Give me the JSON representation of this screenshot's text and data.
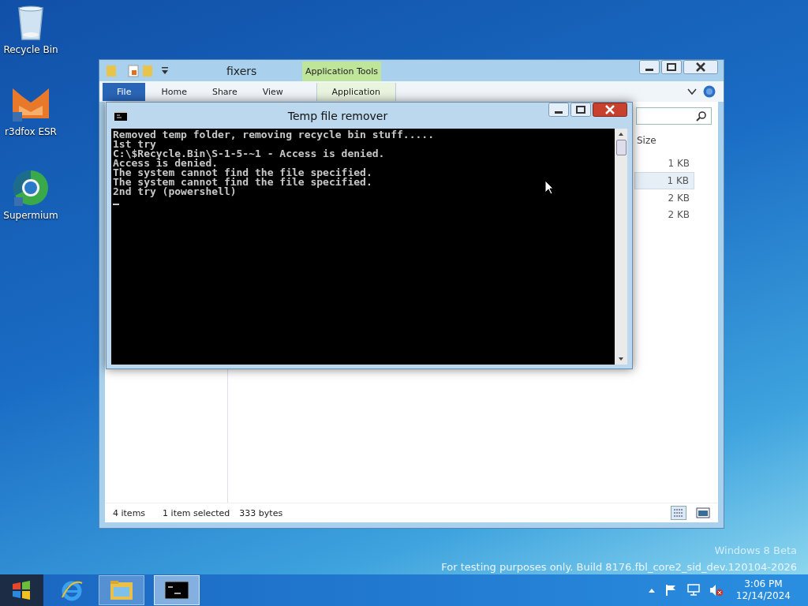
{
  "desktop_icons": [
    {
      "kind": "recycle",
      "label": "Recycle Bin"
    },
    {
      "kind": "fox",
      "label": "r3dfox ESR"
    },
    {
      "kind": "supermium",
      "label": "Supermium"
    }
  ],
  "explorer": {
    "title": "fixers",
    "contextual_group": "Application Tools",
    "tabs": [
      {
        "kind": "file",
        "label": "File"
      },
      {
        "kind": "tab",
        "label": "Home"
      },
      {
        "kind": "tab",
        "label": "Share"
      },
      {
        "kind": "tab",
        "label": "View"
      },
      {
        "kind": "contextual",
        "label": "Application"
      }
    ],
    "columns": [
      "Size"
    ],
    "rows": [
      {
        "size": "1 KB",
        "selected": false
      },
      {
        "size": "1 KB",
        "selected": true
      },
      {
        "size": "2 KB",
        "selected": false
      },
      {
        "size": "2 KB",
        "selected": false
      }
    ],
    "status": {
      "items": "4 items",
      "selection": "1 item selected",
      "bytes": "333 bytes"
    }
  },
  "console": {
    "title": "Temp file remover",
    "lines": [
      "Removed temp folder, removing recycle bin stuff.....",
      "1st try",
      "C:\\$Recycle.Bin\\S-1-5-~1 - Access is denied.",
      "Access is denied.",
      "The system cannot find the file specified.",
      "The system cannot find the file specified.",
      "2nd try (powershell)"
    ]
  },
  "watermark": {
    "edition": "Windows 8 Beta",
    "build": "For testing purposes only. Build 8176.fbl_core2_sid_dev.120104-2026"
  },
  "taskbar": {
    "apps": [
      {
        "kind": "ie",
        "active": false
      },
      {
        "kind": "explorer",
        "active": false
      },
      {
        "kind": "console",
        "active": true
      }
    ],
    "clock": {
      "time": "3:06 PM",
      "date": "12/14/2024"
    }
  }
}
